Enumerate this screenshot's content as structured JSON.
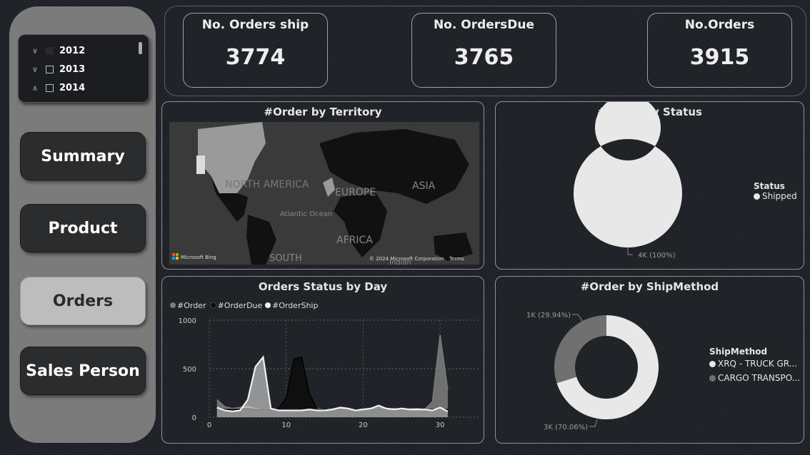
{
  "slicer": {
    "years": [
      {
        "label": "2012",
        "chevron": "∨"
      },
      {
        "label": "2013",
        "chevron": "∨"
      },
      {
        "label": "2014",
        "chevron": "∧"
      }
    ]
  },
  "nav": {
    "summary": "Summary",
    "product": "Product",
    "orders": "Orders",
    "sales_person": "Sales Person"
  },
  "kpis": {
    "ship": {
      "title": "No. Orders ship",
      "value": "3774"
    },
    "due": {
      "title": "No. OrdersDue",
      "value": "3765"
    },
    "orders": {
      "title": "No.Orders",
      "value": "3915"
    }
  },
  "territory": {
    "title": "#Order by Territory",
    "labels": {
      "north_america": "NORTH AMERICA",
      "europe": "EUROPE",
      "asia": "ASIA",
      "africa": "AFRICA",
      "south": "SOUTH",
      "atlantic": "Atlantic Ocean",
      "indian": "Indian"
    },
    "bing": "Microsoft Bing",
    "copyright": "© 2024 Microsoft Corporation",
    "terms": "Terms"
  },
  "status": {
    "title": "#Order by Status",
    "legend_title": "Status",
    "legend_item": "Shipped",
    "data_label": "4K (100%)",
    "color": "#e8e8e8"
  },
  "day_chart": {
    "title": "Orders Status by Day"
  },
  "shipmethod": {
    "title": "#Order by ShipMethod",
    "legend_title": "ShipMethod",
    "items": [
      {
        "label": "XRQ - TRUCK GR...",
        "color": "#e8e8e8"
      },
      {
        "label": "CARGO TRANSPO...",
        "color": "#707070"
      }
    ],
    "labels": {
      "cargo": "1K (29.94%)",
      "truck": "3K (70.06%)"
    }
  },
  "chart_data": [
    {
      "type": "pie",
      "title": "#Order by Status",
      "legend": "Status",
      "categories": [
        "Shipped"
      ],
      "values": [
        100
      ],
      "unit": "percent",
      "data_labels": [
        "4K (100%)"
      ],
      "donut": true
    },
    {
      "type": "pie",
      "title": "#Order by ShipMethod",
      "legend": "ShipMethod",
      "categories": [
        "XRQ - TRUCK GR...",
        "CARGO TRANSPO..."
      ],
      "values": [
        70.06,
        29.94
      ],
      "unit": "percent",
      "data_labels": [
        "3K (70.06%)",
        "1K (29.94%)"
      ],
      "donut": true
    },
    {
      "type": "area",
      "title": "Orders Status by Day",
      "legend_position": "top-left",
      "x": [
        1,
        2,
        3,
        4,
        5,
        6,
        7,
        8,
        9,
        10,
        11,
        12,
        13,
        14,
        15,
        16,
        17,
        18,
        19,
        20,
        21,
        22,
        23,
        24,
        25,
        26,
        27,
        28,
        29,
        30,
        31
      ],
      "xlim": [
        0,
        35
      ],
      "ylim": [
        0,
        1000
      ],
      "xticks": [
        0,
        10,
        20,
        30
      ],
      "yticks": [
        0,
        500,
        1000
      ],
      "grid": true,
      "series": [
        {
          "name": "#Order",
          "color": "#7a7a7a",
          "values": [
            180,
            110,
            90,
            100,
            110,
            90,
            80,
            85,
            90,
            85,
            90,
            80,
            85,
            90,
            80,
            85,
            90,
            85,
            80,
            85,
            90,
            80,
            85,
            90,
            80,
            85,
            90,
            80,
            160,
            850,
            280
          ]
        },
        {
          "name": "#OrderDue",
          "color": "#0d0d0d",
          "values": [
            80,
            80,
            80,
            80,
            90,
            80,
            80,
            80,
            90,
            200,
            600,
            620,
            250,
            80,
            80,
            80,
            80,
            80,
            80,
            80,
            80,
            80,
            80,
            80,
            80,
            80,
            80,
            80,
            80,
            80,
            80
          ]
        },
        {
          "name": "#OrderShip",
          "color": "#f0f0f0",
          "values": [
            100,
            70,
            60,
            70,
            180,
            520,
            620,
            90,
            70,
            70,
            70,
            70,
            80,
            70,
            70,
            80,
            100,
            90,
            70,
            80,
            90,
            120,
            90,
            80,
            90,
            80,
            80,
            80,
            70,
            100,
            60
          ]
        }
      ]
    }
  ]
}
